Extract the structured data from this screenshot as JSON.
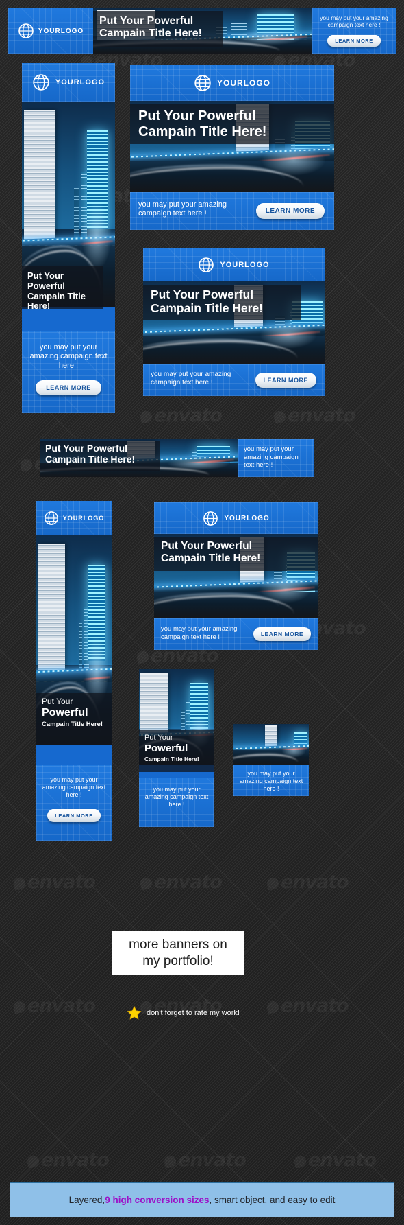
{
  "meta": {
    "logo_text": "YOURLOGO",
    "logo_icon": "globe-icon",
    "title_line1": "Put Your Powerful",
    "title_line2": "Campain Title Here!",
    "title_l1": "Put Your",
    "title_l2": "Powerful",
    "title_l3": "Campain Title Here!",
    "cta_text": "you may put your amazing campaign text here !",
    "cta_text_wrapped": "you may put your\namazing campaign\ntext here !",
    "button_label": "LEARN MORE"
  },
  "banners": [
    {
      "id": "leaderboard-728x90",
      "size_name": "728x90"
    },
    {
      "id": "skyscraper-160x600",
      "size_name": "160x600"
    },
    {
      "id": "medium-rectangle-300x250",
      "size_name": "300x250"
    },
    {
      "id": "large-rectangle-336x280",
      "size_name": "336x280"
    },
    {
      "id": "leaderboard-468x60",
      "size_name": "468x60"
    },
    {
      "id": "wide-skyscraper-120x600",
      "size_name": "120x600"
    },
    {
      "id": "rectangle-300x250-b",
      "size_name": "300x250"
    },
    {
      "id": "half-banner-180x150",
      "size_name": "180x150"
    },
    {
      "id": "square-200x200",
      "size_name": "200x200"
    }
  ],
  "footer": {
    "portfolio_line1": "more banners on",
    "portfolio_line2": "my portfolio!",
    "rate_icon": "star-icon",
    "rate_text": "don't forget to rate my work!",
    "feature_pre": "Layered, ",
    "feature_highlight": "9 high conversion sizes",
    "feature_post": ", smart object, and easy to edit"
  },
  "watermark": {
    "text": "envato"
  },
  "colors": {
    "brand_blue": "#1a6fd4",
    "plate_dark": "#101820",
    "button_text": "#16539c",
    "feature_bar_bg": "#8fc0e8",
    "highlight_purple": "#9c12c7",
    "star_yellow": "#ffd400"
  }
}
